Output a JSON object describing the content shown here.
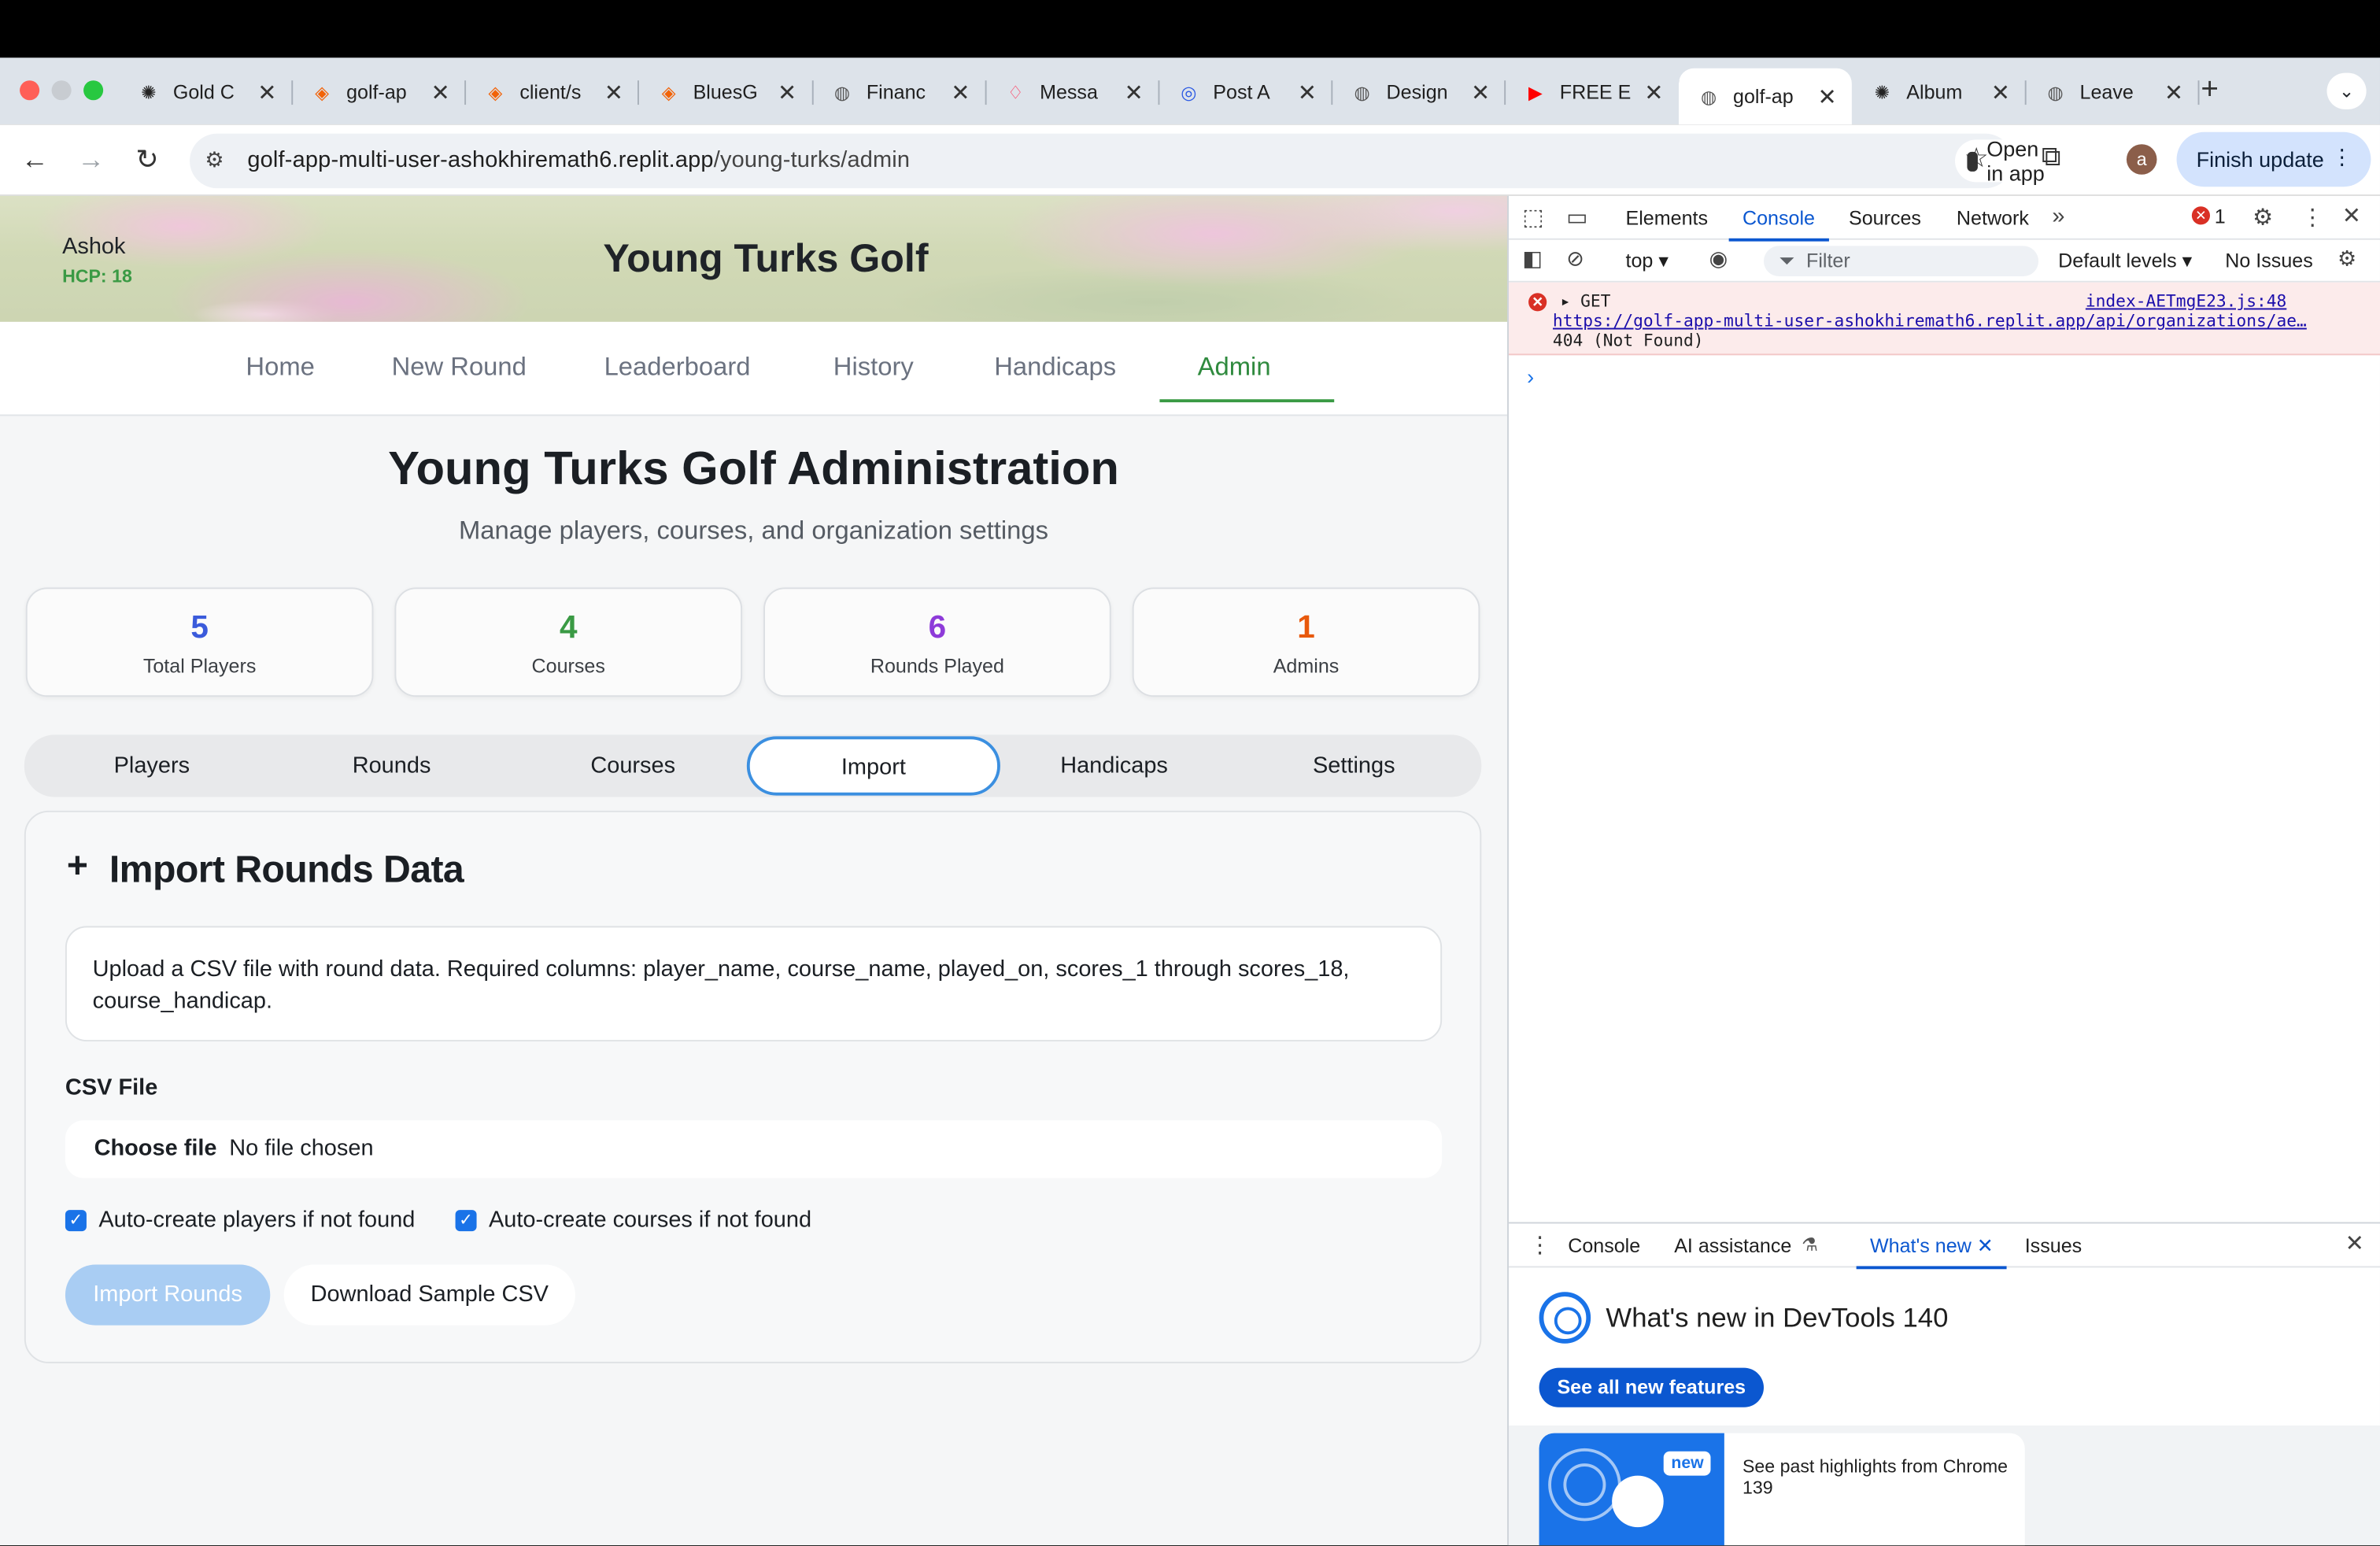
{
  "browser": {
    "tabs": [
      {
        "title": "Gold C",
        "icon": "openai-icon"
      },
      {
        "title": "golf-ap",
        "icon": "replit-icon"
      },
      {
        "title": "client/s",
        "icon": "replit-icon"
      },
      {
        "title": "BluesG",
        "icon": "replit-icon"
      },
      {
        "title": "Financ",
        "icon": "globe-icon"
      },
      {
        "title": "Messa",
        "icon": "airbnb-icon"
      },
      {
        "title": "Post A",
        "icon": "zm-icon"
      },
      {
        "title": "Design",
        "icon": "globe-icon"
      },
      {
        "title": "FREE E",
        "icon": "youtube-icon"
      },
      {
        "title": "golf-ap",
        "icon": "globe-icon",
        "active": true
      },
      {
        "title": "Album",
        "icon": "openai-icon"
      },
      {
        "title": "Leave",
        "icon": "globe-icon"
      }
    ],
    "url_host": "golf-app-multi-user-ashokhiremath6.replit.app",
    "url_path": "/young-turks/admin",
    "open_in_app": "Open in app",
    "finish_update": "Finish update",
    "profile_initial": "a"
  },
  "app": {
    "user": {
      "name": "Ashok",
      "hcp": "HCP: 18"
    },
    "brand": "Young Turks Golf",
    "nav": [
      "Home",
      "New Round",
      "Leaderboard",
      "History",
      "Handicaps",
      "Admin"
    ],
    "nav_active": "Admin",
    "page_title": "Young Turks Golf Administration",
    "page_subtitle": "Manage players, courses, and organization settings",
    "stats": [
      {
        "value": "5",
        "label": "Total Players",
        "color": "#3b5bdb"
      },
      {
        "value": "4",
        "label": "Courses",
        "color": "#3a9a44"
      },
      {
        "value": "6",
        "label": "Rounds Played",
        "color": "#8e3bd9"
      },
      {
        "value": "1",
        "label": "Admins",
        "color": "#e8590c"
      }
    ],
    "subtabs": [
      "Players",
      "Rounds",
      "Courses",
      "Import",
      "Handicaps",
      "Settings"
    ],
    "subtab_active": "Import",
    "import": {
      "title": "Import Rounds Data",
      "info": "Upload a CSV file with round data. Required columns: player_name, course_name, played_on, scores_1 through scores_18, course_handicap.",
      "file_label": "CSV File",
      "choose_file": "Choose file",
      "no_file": "No file chosen",
      "auto_players": "Auto-create players if not found",
      "auto_courses": "Auto-create courses if not found",
      "auto_players_checked": true,
      "auto_courses_checked": true,
      "import_button": "Import Rounds",
      "sample_button": "Download Sample CSV"
    }
  },
  "devtools": {
    "tabs": [
      "Elements",
      "Console",
      "Sources",
      "Network"
    ],
    "active_tab": "Console",
    "error_count": "1",
    "context": "top",
    "filter_placeholder": "Filter",
    "levels": "Default levels",
    "issues": "No Issues",
    "error": {
      "method": "GET",
      "source": "index-AETmgE23.js:48",
      "url": "https://golf-app-multi-user-ashokhiremath6.replit.app/api/organizations/ae…",
      "status": "404 (Not Found)"
    },
    "drawer": {
      "tabs": [
        "Console",
        "AI assistance",
        "What's new",
        "Issues"
      ],
      "active_tab": "What's new",
      "title": "What's new in DevTools 140",
      "see_all": "See all new features",
      "highlight_badge": "new",
      "highlight_text": "See past highlights from Chrome 139"
    }
  }
}
